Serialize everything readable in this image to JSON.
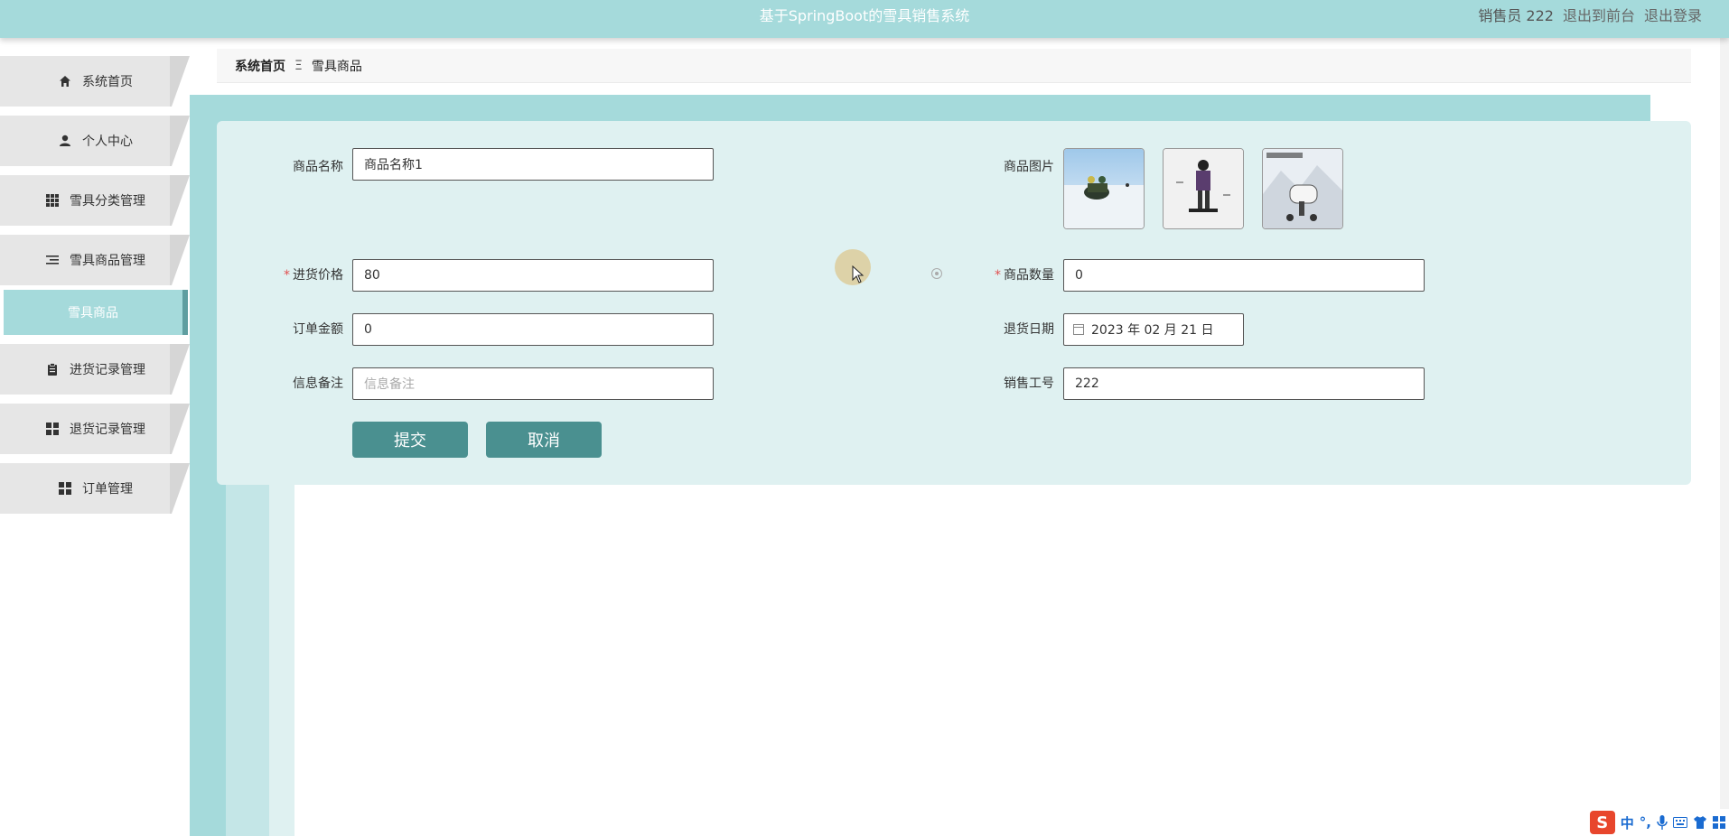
{
  "header": {
    "title": "基于SpringBoot的雪具销售系统",
    "user": "销售员 222",
    "to_front": "退出到前台",
    "logout": "退出登录"
  },
  "sidebar": {
    "items": [
      {
        "label": "系统首页",
        "icon": "home-icon"
      },
      {
        "label": "个人中心",
        "icon": "person-icon"
      },
      {
        "label": "雪具分类管理",
        "icon": "grid-icon"
      },
      {
        "label": "雪具商品管理",
        "icon": "list-icon"
      },
      {
        "label": "进货记录管理",
        "icon": "clipboard-icon"
      },
      {
        "label": "退货记录管理",
        "icon": "apps-icon"
      },
      {
        "label": "订单管理",
        "icon": "apps-icon"
      }
    ],
    "sub_item": "雪具商品"
  },
  "breadcrumb": {
    "home": "系统首页",
    "separator": "Ξ",
    "current": "雪具商品"
  },
  "form": {
    "product_name_label": "商品名称",
    "product_name_value": "商品名称1",
    "product_image_label": "商品图片",
    "purchase_price_label": "进货价格",
    "purchase_price_value": "80",
    "quantity_label": "商品数量",
    "quantity_value": "0",
    "order_amount_label": "订单金额",
    "order_amount_value": "0",
    "return_date_label": "退货日期",
    "return_date_value": "2023 年 02 月 21 日",
    "note_label": "信息备注",
    "note_placeholder": "信息备注",
    "staff_no_label": "销售工号",
    "staff_no_value": "222",
    "required_mark": "*",
    "submit": "提交",
    "cancel": "取消"
  },
  "ime": {
    "logo": "S",
    "lang": "中",
    "punct": "°,"
  },
  "colors": {
    "header": "#a5dadb",
    "card": "#dff1f1",
    "button": "#4a9090",
    "sidebar_active": "#a5dadb"
  }
}
